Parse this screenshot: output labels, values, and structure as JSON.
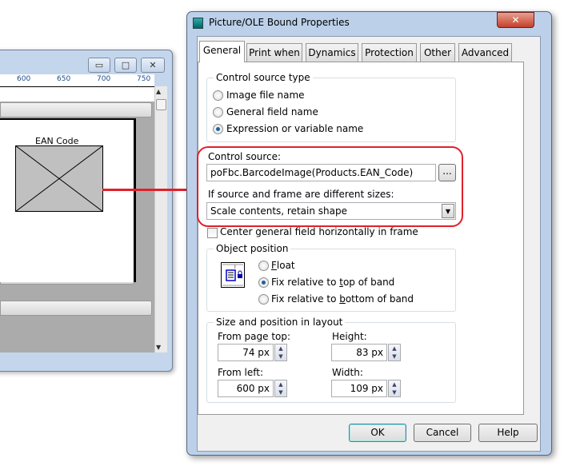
{
  "left_window": {
    "ruler": [
      "600",
      "650",
      "700",
      "750"
    ],
    "field_label": "EAN Code",
    "buttons": {
      "minimize": "▭",
      "maximize": "□",
      "close": "✕"
    }
  },
  "dialog": {
    "title": "Picture/OLE Bound Properties",
    "tabs": [
      {
        "label": "General",
        "active": true
      },
      {
        "label": "Print when"
      },
      {
        "label": "Dynamics"
      },
      {
        "label": "Protection"
      },
      {
        "label": "Other"
      },
      {
        "label": "Advanced"
      }
    ],
    "control_source_type": {
      "legend": "Control source type",
      "options": [
        {
          "label": "Image file name",
          "selected": false
        },
        {
          "label": "General field name",
          "selected": false
        },
        {
          "label": "Expression or variable name",
          "selected": true
        }
      ]
    },
    "control_source": {
      "label": "Control source:",
      "value": "poFbc.BarcodeImage(Products.EAN_Code)",
      "browse": "..."
    },
    "size_mode": {
      "label": "If source and frame are different sizes:",
      "value": "Scale contents, retain shape"
    },
    "center_checkbox": {
      "label": "Center general field horizontally in frame",
      "checked": false
    },
    "object_position": {
      "legend": "Object position",
      "options": [
        {
          "pre": "",
          "key": "F",
          "post": "loat",
          "selected": false
        },
        {
          "pre": "Fix relative to ",
          "key": "t",
          "post": "op of band",
          "selected": true
        },
        {
          "pre": "Fix relative to ",
          "key": "b",
          "post": "ottom of band",
          "selected": false
        }
      ]
    },
    "size_position": {
      "legend": "Size and position in layout",
      "from_top": {
        "label": "From page top:",
        "value": "74 px"
      },
      "height": {
        "label": "Height:",
        "value": "83 px"
      },
      "from_left": {
        "label": "From left:",
        "value": "600 px"
      },
      "width": {
        "label": "Width:",
        "value": "109 px"
      }
    },
    "buttons": {
      "ok": "OK",
      "cancel": "Cancel",
      "help": "Help",
      "close": "✕"
    }
  },
  "colors": {
    "highlight": "#e0202a",
    "accent": "#1f5f9f"
  }
}
